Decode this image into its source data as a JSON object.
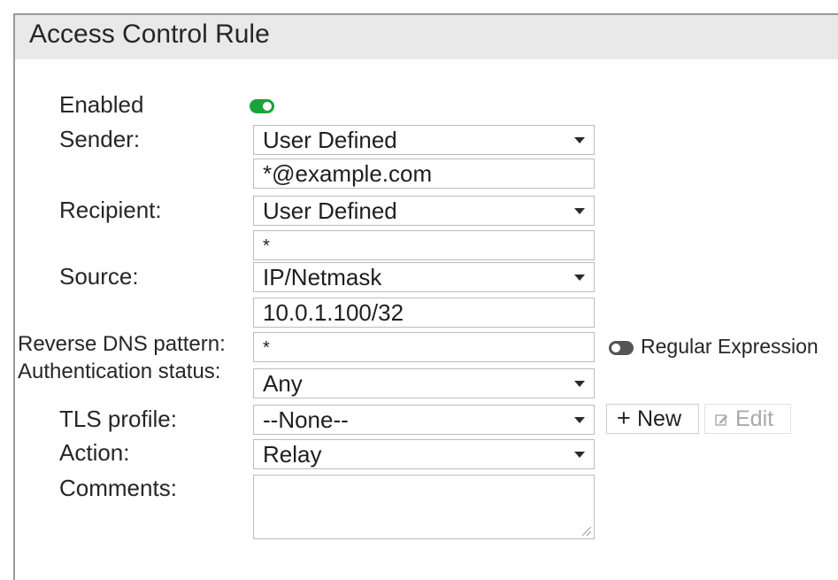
{
  "window": {
    "title": "Access Control Rule"
  },
  "enabled": {
    "label": "Enabled",
    "state": true
  },
  "sender": {
    "label": "Sender:",
    "type": "User Defined",
    "value": "*@example.com"
  },
  "recipient": {
    "label": "Recipient:",
    "type": "User Defined",
    "value": "*"
  },
  "source": {
    "label": "Source:",
    "type": "IP/Netmask",
    "value": "10.0.1.100/32"
  },
  "reverse_dns": {
    "label": "Reverse DNS pattern:",
    "value": "*",
    "regex_label": "Regular Expression",
    "regex_state": false
  },
  "auth_status": {
    "label": "Authentication status:",
    "value": "Any"
  },
  "tls_profile": {
    "label": "TLS profile:",
    "value": "--None--",
    "new_label": "New",
    "edit_label": "Edit"
  },
  "action": {
    "label": "Action:",
    "value": "Relay"
  },
  "comments": {
    "label": "Comments:",
    "value": ""
  },
  "colors": {
    "toggle_on": "#1aa33c",
    "toggle_off": "#555555",
    "disabled_text": "#a9a9a9"
  },
  "icons": {
    "new": "plus-icon",
    "edit": "edit-icon",
    "dropdown": "chevron-down-icon"
  }
}
